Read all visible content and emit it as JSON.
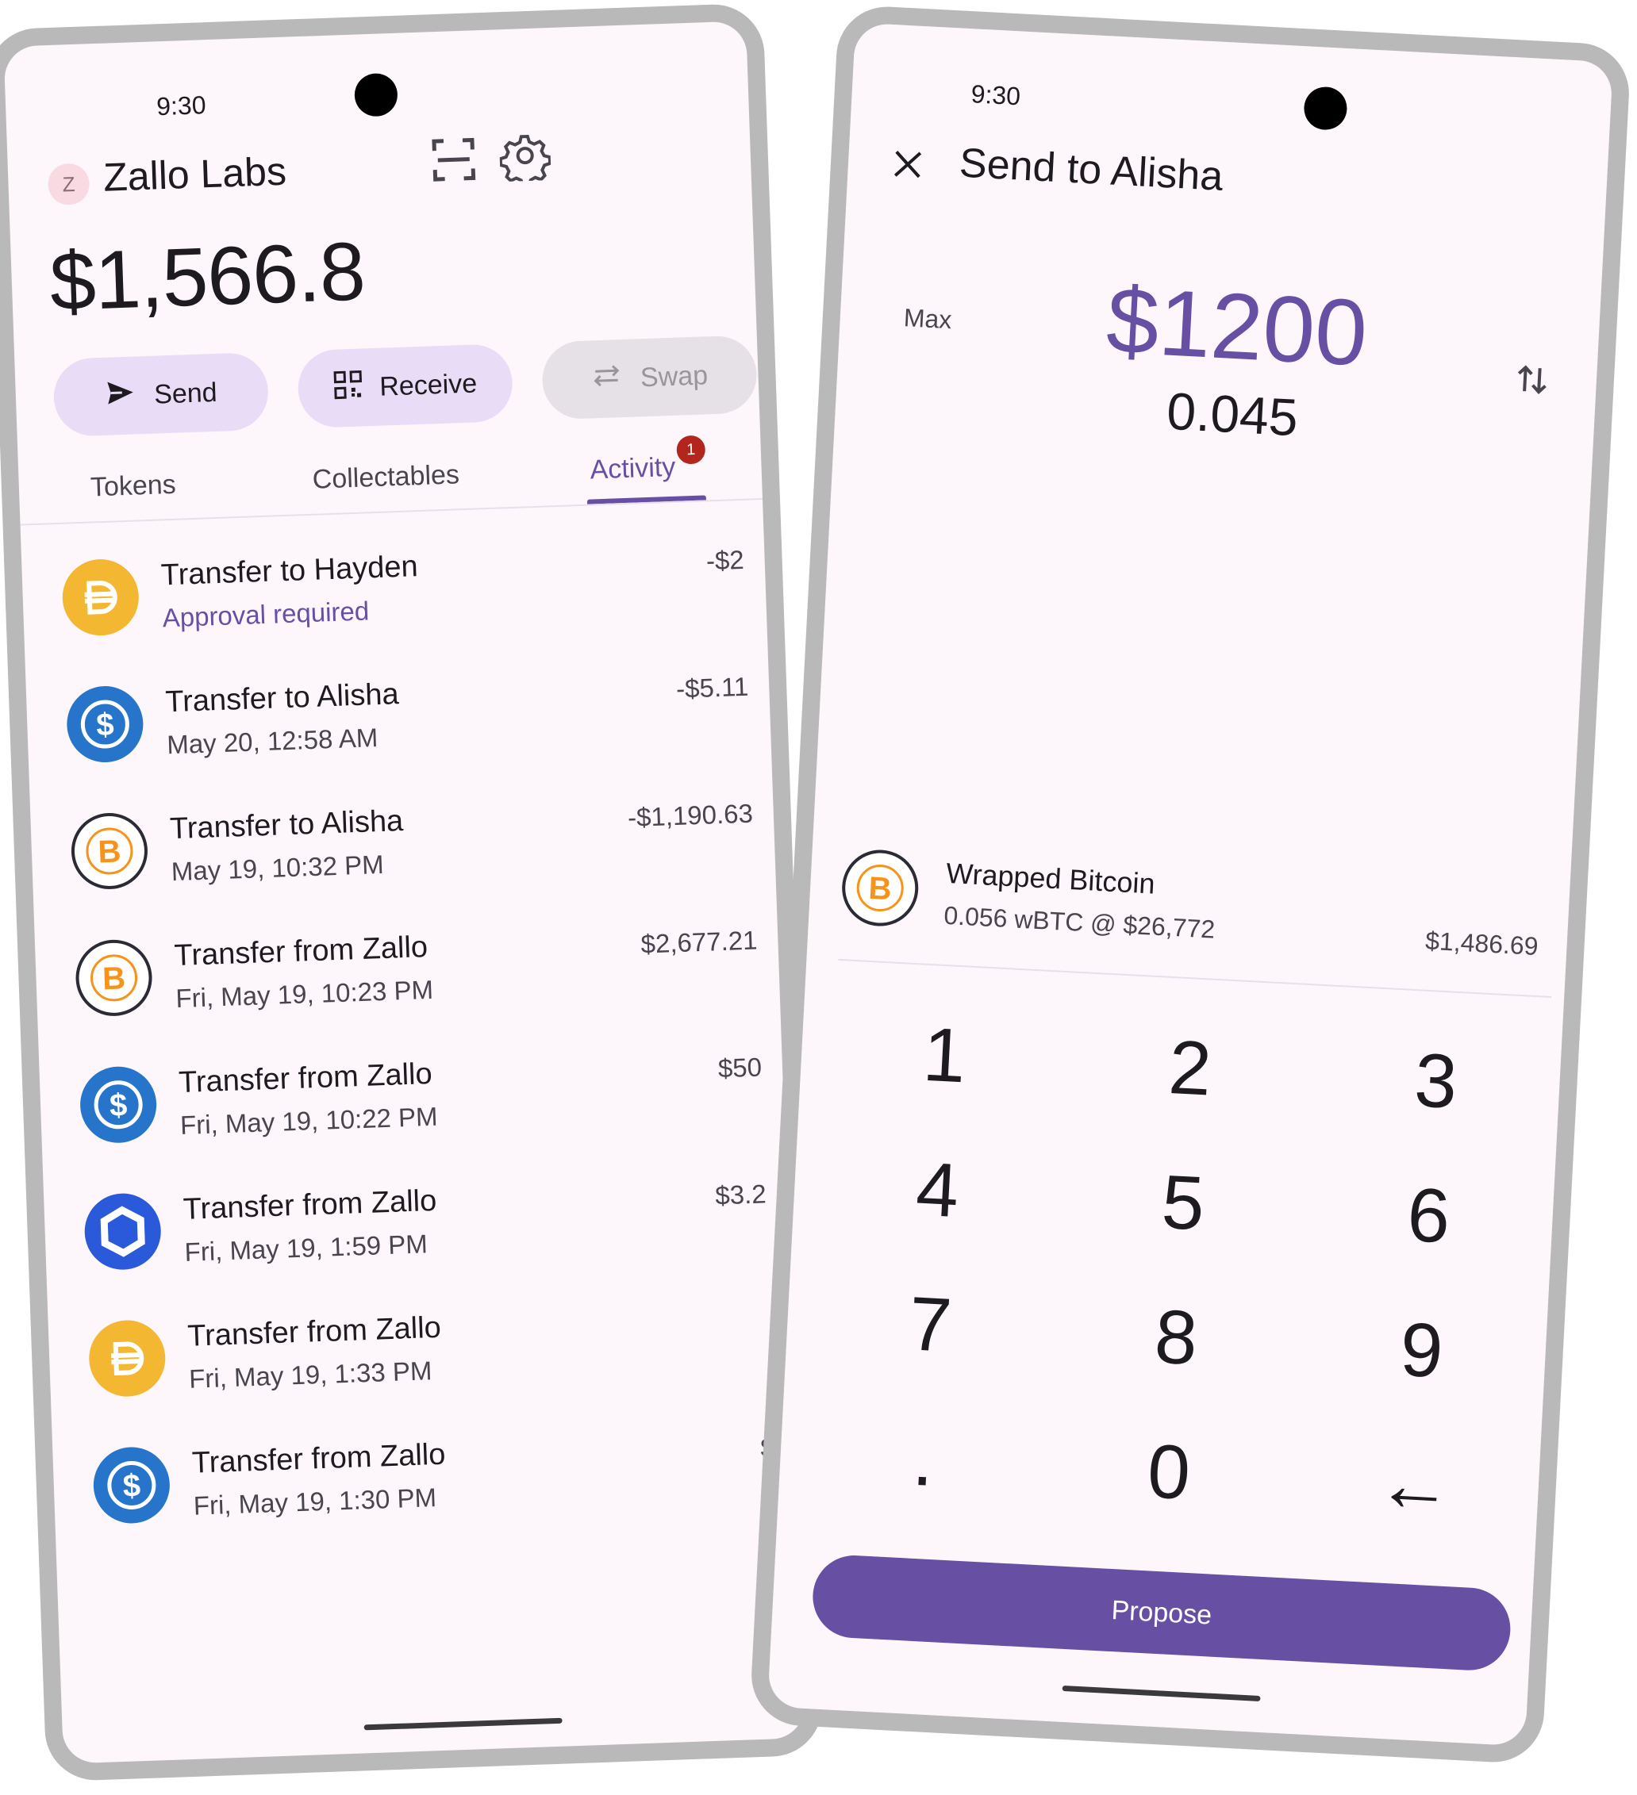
{
  "left": {
    "status_time": "9:30",
    "avatar_initial": "Z",
    "wallet_name": "Zallo Labs",
    "balance": "$1,566.8",
    "actions": {
      "send": "Send",
      "receive": "Receive",
      "swap": "Swap"
    },
    "tabs": {
      "tokens": "Tokens",
      "collectables": "Collectables",
      "activity": "Activity",
      "activity_badge": "1"
    },
    "transactions": [
      {
        "icon": "dai-icon",
        "title": "Transfer to Hayden",
        "subtitle": "Approval required",
        "amount": "-$2"
      },
      {
        "icon": "usdc-icon",
        "title": "Transfer to Alisha",
        "subtitle": "May 20, 12:58 AM",
        "amount": "-$5.11"
      },
      {
        "icon": "wbtc-icon",
        "title": "Transfer to Alisha",
        "subtitle": "May 19, 10:32 PM",
        "amount": "-$1,190.63"
      },
      {
        "icon": "wbtc-icon",
        "title": "Transfer from Zallo",
        "subtitle": "Fri, May 19, 10:23 PM",
        "amount": "$2,677.21"
      },
      {
        "icon": "usdc-icon",
        "title": "Transfer from Zallo",
        "subtitle": "Fri, May 19, 10:22 PM",
        "amount": "$50"
      },
      {
        "icon": "link-icon",
        "title": "Transfer from Zallo",
        "subtitle": "Fri, May 19, 1:59 PM",
        "amount": "$3.2"
      },
      {
        "icon": "dai-icon",
        "title": "Transfer from Zallo",
        "subtitle": "Fri, May 19, 1:33 PM",
        "amount": ""
      },
      {
        "icon": "usdc-icon",
        "title": "Transfer from Zallo",
        "subtitle": "Fri, May 19, 1:30 PM",
        "amount": "$"
      }
    ]
  },
  "right": {
    "status_time": "9:30",
    "title": "Send to Alisha",
    "max_label": "Max",
    "amount_fiat": "$1200",
    "amount_token": "0.045",
    "asset": {
      "name": "Wrapped Bitcoin",
      "detail": "0.056 wBTC @ $26,772",
      "value": "$1,486.69"
    },
    "keypad": [
      "1",
      "2",
      "3",
      "4",
      "5",
      "6",
      "7",
      "8",
      "9",
      ".",
      "0",
      "←"
    ],
    "propose_label": "Propose"
  },
  "colors": {
    "accent": "#6750a4",
    "accent_container": "#e9dcf7",
    "surface": "#fdf7fc",
    "badge": "#b3261e"
  }
}
